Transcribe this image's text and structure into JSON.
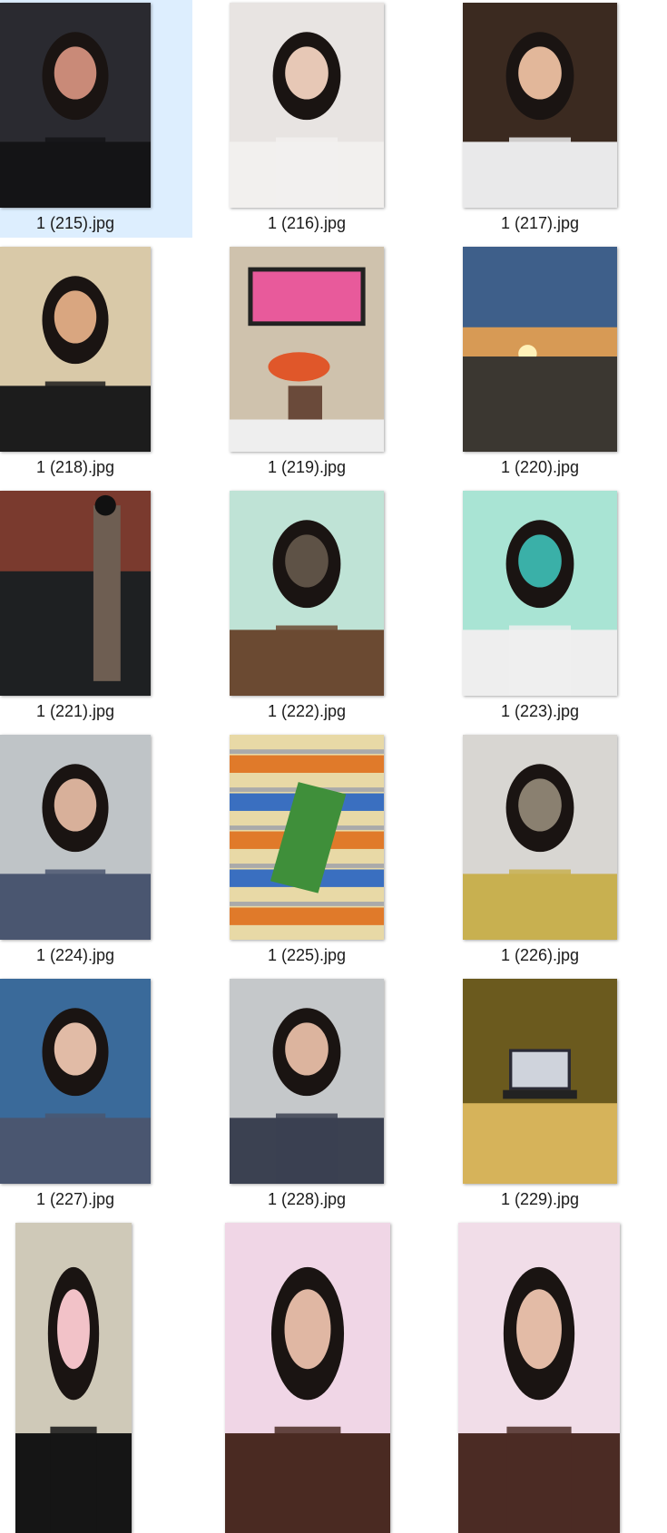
{
  "files": [
    {
      "name": "1 (215).jpg",
      "selected": true,
      "scene": "selfie-night-street",
      "palette": [
        "#2a2a30",
        "#141416",
        "#c98a78"
      ]
    },
    {
      "name": "1 (216).jpg",
      "selected": false,
      "scene": "selfie-white-hoodie",
      "palette": [
        "#e8e4e2",
        "#f2f0ee",
        "#e7c8b6"
      ]
    },
    {
      "name": "1 (217).jpg",
      "selected": false,
      "scene": "peace-sign-cafe",
      "palette": [
        "#3b2a20",
        "#e9e9ea",
        "#e2b79a"
      ]
    },
    {
      "name": "1 (218).jpg",
      "selected": false,
      "scene": "selfie-earphones",
      "palette": [
        "#d9c9a8",
        "#1c1c1c",
        "#d9a680"
      ]
    },
    {
      "name": "1 (219).jpg",
      "selected": false,
      "scene": "desk-setup-monitor",
      "palette": [
        "#cfc2ad",
        "#e85a9b",
        "#e0572a"
      ]
    },
    {
      "name": "1 (220).jpg",
      "selected": false,
      "scene": "sunset-parking-lot",
      "palette": [
        "#3e5f8a",
        "#f2b65a",
        "#3b3731"
      ]
    },
    {
      "name": "1 (221).jpg",
      "selected": false,
      "scene": "grill-counter",
      "palette": [
        "#7a3a2e",
        "#1e2022",
        "#6e5e52"
      ]
    },
    {
      "name": "1 (222).jpg",
      "selected": false,
      "scene": "mirror-selfie-mint-room",
      "palette": [
        "#bfe3d6",
        "#6b4a32",
        "#5e5246"
      ]
    },
    {
      "name": "1 (223).jpg",
      "selected": false,
      "scene": "selfie-glasses-bed",
      "palette": [
        "#a9e4d4",
        "#eeeeee",
        "#3ab0a8"
      ]
    },
    {
      "name": "1 (224).jpg",
      "selected": false,
      "scene": "selfie-train-station",
      "palette": [
        "#bfc4c7",
        "#4a5670",
        "#d8b09a"
      ]
    },
    {
      "name": "1 (225).jpg",
      "selected": false,
      "scene": "matcha-latte-store-shelf",
      "palette": [
        "#e8d9a6",
        "#3f8f3a",
        "#3a6fc0"
      ]
    },
    {
      "name": "1 (226).jpg",
      "selected": false,
      "scene": "mirror-selfie-shop",
      "palette": [
        "#d8d6d2",
        "#c8b050",
        "#8a8070"
      ]
    },
    {
      "name": "1 (227).jpg",
      "selected": false,
      "scene": "selfie-city-buildings",
      "palette": [
        "#3a6a9a",
        "#4a5670",
        "#e1bba6"
      ]
    },
    {
      "name": "1 (228).jpg",
      "selected": false,
      "scene": "selfie-station-platform",
      "palette": [
        "#c5c8ca",
        "#3b4151",
        "#dcb49e"
      ]
    },
    {
      "name": "1 (229).jpg",
      "selected": false,
      "scene": "laptop-anime-yellow-room",
      "palette": [
        "#6b5a1e",
        "#d6b35a",
        "#2a2a36"
      ]
    },
    {
      "name": "",
      "selected": false,
      "scene": "portrait-off-shoulder-top",
      "palette": [
        "#cfc9b8",
        "#151515",
        "#f2c2c8"
      ]
    },
    {
      "name": "",
      "selected": false,
      "scene": "brown-dress-pink-room",
      "palette": [
        "#f0d6e6",
        "#4a2a22",
        "#e0b7a3"
      ]
    },
    {
      "name": "",
      "selected": false,
      "scene": "brown-dress-sitting",
      "palette": [
        "#f1dde8",
        "#4b2b24",
        "#e3bba6"
      ]
    }
  ]
}
